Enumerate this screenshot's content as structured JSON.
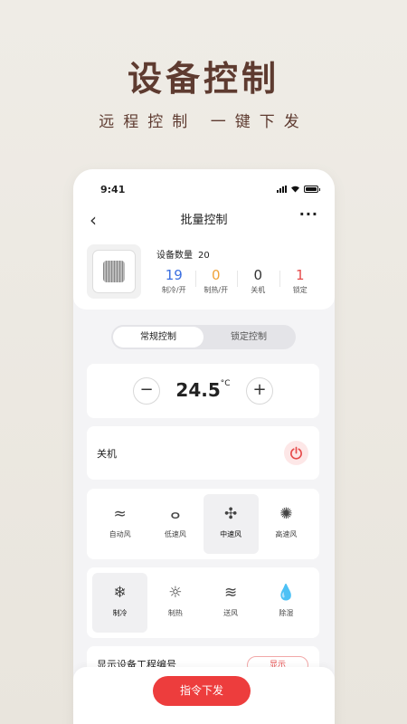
{
  "promo": {
    "title": "设备控制",
    "subtitle": "远程控制  一键下发"
  },
  "status_bar": {
    "time": "9:41"
  },
  "nav": {
    "back": "‹",
    "title": "批量控制",
    "more": "···"
  },
  "device": {
    "count_label": "设备数量",
    "count_value": "20",
    "stats": [
      {
        "value": "19",
        "label": "制冷/开",
        "color": "#3b6fe0"
      },
      {
        "value": "0",
        "label": "制热/开",
        "color": "#f0a33a"
      },
      {
        "value": "0",
        "label": "关机",
        "color": "#333333"
      },
      {
        "value": "1",
        "label": "锁定",
        "color": "#e64b4b"
      }
    ]
  },
  "segment": {
    "normal": "常规控制",
    "lock": "锁定控制"
  },
  "temperature": {
    "value": "24.5",
    "unit": "°C",
    "minus": "−",
    "plus": "+"
  },
  "power": {
    "label": "关机"
  },
  "fan_speeds": [
    {
      "label": "自动风",
      "icon": "auto-fan-icon",
      "glyph": "≈",
      "selected": false
    },
    {
      "label": "低速风",
      "icon": "low-fan-icon",
      "glyph": "ⴰ",
      "selected": false
    },
    {
      "label": "中速风",
      "icon": "medium-fan-icon",
      "glyph": "✣",
      "selected": true
    },
    {
      "label": "高速风",
      "icon": "high-fan-icon",
      "glyph": "✺",
      "selected": false
    }
  ],
  "modes": [
    {
      "label": "制冷",
      "icon": "snowflake-icon",
      "glyph": "❄",
      "selected": true
    },
    {
      "label": "制热",
      "icon": "sun-icon",
      "glyph": "☼",
      "selected": false
    },
    {
      "label": "送风",
      "icon": "wind-icon",
      "glyph": "≋",
      "selected": false
    },
    {
      "label": "除湿",
      "icon": "droplet-icon",
      "glyph": "💧",
      "selected": false
    }
  ],
  "engineering": {
    "label": "显示设备工程编号",
    "button": "显示"
  },
  "submit": {
    "label": "指令下发"
  },
  "colors": {
    "accent": "#ed3d3d",
    "brand_text": "#5e3b30"
  }
}
